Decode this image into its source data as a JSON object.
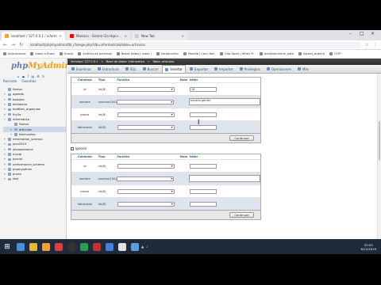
{
  "browser": {
    "tabs": [
      {
        "title": "localhost / 127.0.0.1 / informaci",
        "icon": "phpmyadmin-icon",
        "color": "#f0a030"
      },
      {
        "title": "Masiaru - Gremo Cla Hqe>...",
        "icon": "youtube-icon",
        "color": "#ff0000"
      },
      {
        "title": "New Tab",
        "icon": "blank-page-icon",
        "color": "#cccccc"
      }
    ],
    "url": "localhost/phpmyadmin/tbl_change.php?db=informatica&table=articulos",
    "bookmarks": [
      "Aplicaciones",
      "Index a Evale",
      "Oracle",
      "Análisis de procesos",
      "Bases Datos | Index i",
      "Introducción",
      "Moodle | Conc Net.",
      "Cow Sport | Whey Pr.",
      "localhost:home_dato",
      "Aspect_ouser'e",
      "ITOP"
    ]
  },
  "sidebar": {
    "logo_php": "php",
    "logo_myadmin": "MyAdmin",
    "tabs": [
      "Reciente",
      "Favoritas"
    ],
    "tree": [
      {
        "label": "Nueva",
        "level": 0,
        "toggle": ""
      },
      {
        "label": "agenda",
        "level": 0,
        "toggle": "+"
      },
      {
        "label": "bawjare",
        "level": 0,
        "toggle": "+"
      },
      {
        "label": "biblioteca",
        "level": 0,
        "toggle": "+"
      },
      {
        "label": "bodfben_orgasnias",
        "level": 0,
        "toggle": "+"
      },
      {
        "label": "fhy2e",
        "level": 0,
        "toggle": "+"
      },
      {
        "label": "informatica",
        "level": 0,
        "toggle": "−"
      },
      {
        "label": "Nueva",
        "level": 1,
        "toggle": ""
      },
      {
        "label": "articulos",
        "level": 1,
        "toggle": "+"
      },
      {
        "label": "fabricantes",
        "level": 1,
        "toggle": "+"
      },
      {
        "label": "information_schema",
        "level": 0,
        "toggle": "+"
      },
      {
        "label": "java2019",
        "level": 0,
        "toggle": "+"
      },
      {
        "label": "javaoadvance",
        "level": 0,
        "toggle": "+"
      },
      {
        "label": "mysql",
        "level": 0,
        "toggle": "+"
      },
      {
        "label": "parcial",
        "level": 0,
        "toggle": "+"
      },
      {
        "label": "performance_schema",
        "level": 0,
        "toggle": "+"
      },
      {
        "label": "phpmyadmin",
        "level": 0,
        "toggle": "+"
      },
      {
        "label": "prueo",
        "level": 0,
        "toggle": "+"
      },
      {
        "label": "test",
        "level": 0,
        "toggle": "+"
      }
    ]
  },
  "breadcrumbs": [
    "Servidor: 127.0.0.1",
    "Base de datos: informatica",
    "Tabla: articulos"
  ],
  "menu_tabs": [
    "Examinar",
    "Estructura",
    "SQL",
    "Buscar",
    "Insertar",
    "Exportar",
    "Importar",
    "Privilegios",
    "Operaciones",
    "Más"
  ],
  "active_tab": "Insertar",
  "table_headers": {
    "column": "Columna",
    "type": "Tipo",
    "function": "Función",
    "null": "Nulo",
    "value": "Valor"
  },
  "form1": {
    "rows": [
      {
        "column": "id",
        "type": "int(8)",
        "value": "16"
      },
      {
        "column": "nombre",
        "type": "varchar(100)",
        "value": "escaño gamer"
      },
      {
        "column": "precio",
        "type": "int(8)",
        "value": ""
      },
      {
        "column": "fabricante",
        "type": "int(8)",
        "value": ""
      }
    ],
    "submit": "Continuar"
  },
  "ignore_label": "Ignorar",
  "form2": {
    "rows": [
      {
        "column": "id",
        "type": "int(8)",
        "value": ""
      },
      {
        "column": "nombre",
        "type": "varchar(100)",
        "value": ""
      },
      {
        "column": "precio",
        "type": "int(8)",
        "value": ""
      },
      {
        "column": "fabricante",
        "type": "int(8)",
        "value": ""
      }
    ],
    "submit": "Continuar"
  },
  "console_label": "Consola",
  "taskbar": {
    "time": "20:53",
    "date": "6/12/2019",
    "icons": [
      "#4a90d9",
      "#e8b73a",
      "#f0a030",
      "#d94040",
      "#333333",
      "#2a9d55",
      "#c03030",
      "#4a7fd9",
      "#e0e0e0",
      "#5aa0e0"
    ]
  }
}
